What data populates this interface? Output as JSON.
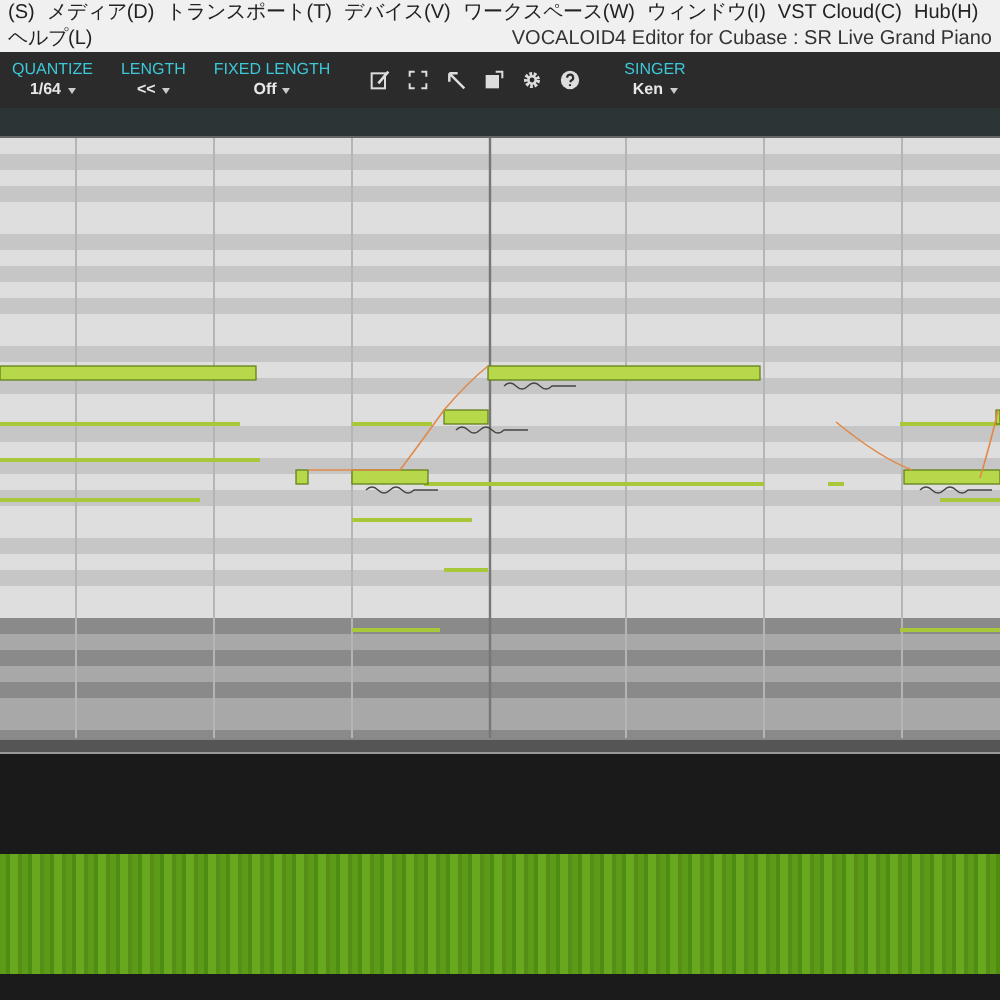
{
  "menu": [
    "(S)",
    "メディア(D)",
    "トランスポート(T)",
    "デバイス(V)",
    "ワークスペース(W)",
    "ウィンドウ(I)",
    "VST Cloud(C)",
    "Hub(H)",
    "ヘルプ(L)"
  ],
  "window": {
    "title": "VOCALOID4 Editor for Cubase : SR Live Grand Piano"
  },
  "toolbar": {
    "dropdowns": [
      {
        "label": "QUANTIZE",
        "value": "1/64"
      },
      {
        "label": "LENGTH",
        "value": "<<"
      },
      {
        "label": "FIXED LENGTH",
        "value": "Off"
      }
    ],
    "tools": [
      {
        "kind": "pencil"
      },
      {
        "kind": "select"
      },
      {
        "kind": "line"
      },
      {
        "kind": "edit"
      },
      {
        "kind": "gear"
      },
      {
        "kind": "help"
      }
    ],
    "singer": {
      "label": "SINGER",
      "value": "Ken"
    }
  }
}
